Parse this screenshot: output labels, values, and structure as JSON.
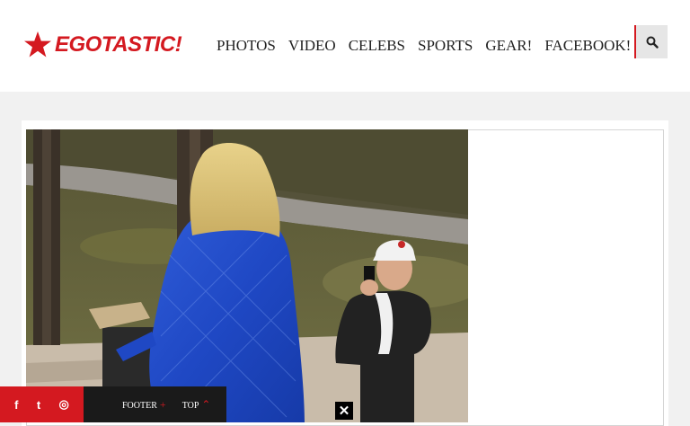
{
  "brand": {
    "name": "EGOTASTIC!",
    "color": "#d41920",
    "icon": "star-icon"
  },
  "nav": {
    "items": [
      {
        "label": "PHOTOS"
      },
      {
        "label": "VIDEO"
      },
      {
        "label": "CELEBS"
      },
      {
        "label": "SPORTS"
      },
      {
        "label": "GEAR!"
      },
      {
        "label": "FACEBOOK!"
      }
    ]
  },
  "search": {
    "icon": "search-icon"
  },
  "social": {
    "items": [
      {
        "icon": "facebook-icon",
        "glyph": "f"
      },
      {
        "icon": "twitter-icon",
        "glyph": "t"
      },
      {
        "icon": "instagram-icon",
        "glyph": "◎"
      }
    ]
  },
  "footer_bar": {
    "footer_label": "FOOTER",
    "footer_mark": "+",
    "top_label": "TOP",
    "top_mark": "⌃"
  },
  "close": {
    "glyph": "✕",
    "icon": "close-icon"
  },
  "photo": {
    "alt": ""
  }
}
